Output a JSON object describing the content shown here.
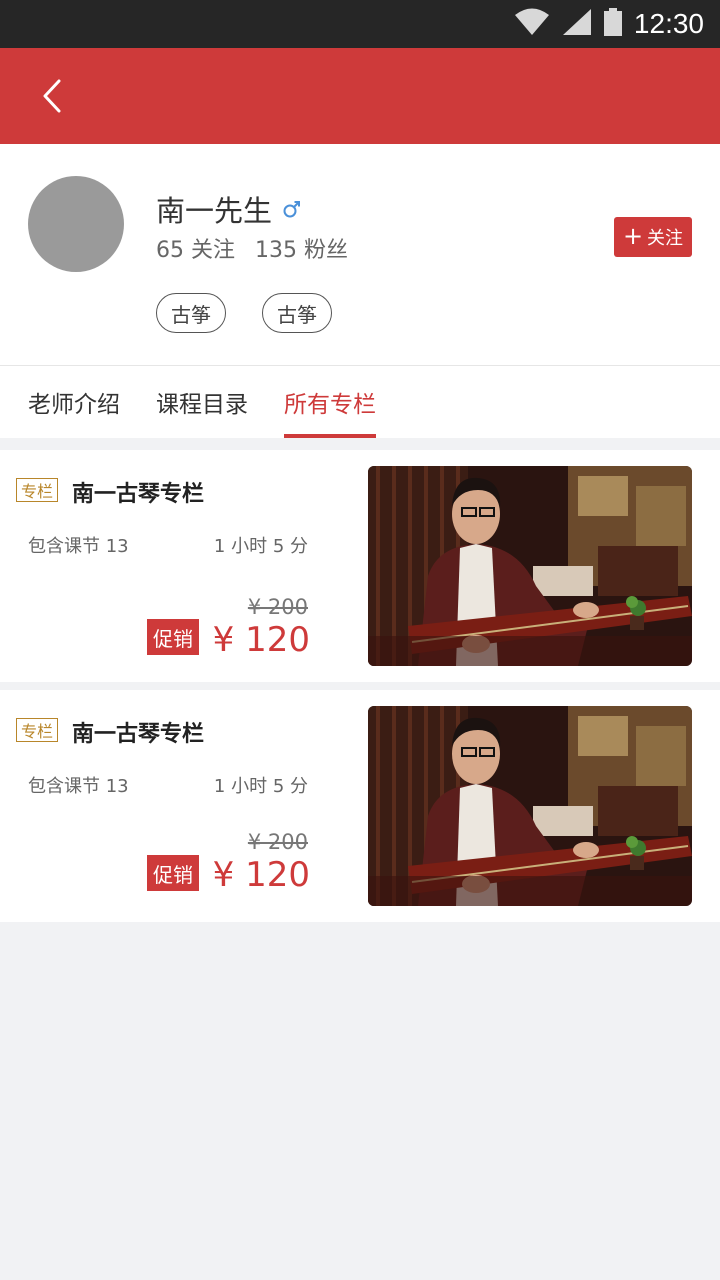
{
  "status_bar": {
    "time": "12:30",
    "icons": [
      "wifi-icon",
      "signal-icon",
      "battery-icon"
    ]
  },
  "profile": {
    "name": "南一先生",
    "gender": "male",
    "following": "65 关注",
    "followers": "135 粉丝",
    "follow_button": "关注",
    "tags": [
      "古筝",
      "古筝"
    ]
  },
  "tabs": [
    {
      "label": "老师介绍",
      "active": false
    },
    {
      "label": "课程目录",
      "active": false
    },
    {
      "label": "所有专栏",
      "active": true
    }
  ],
  "columns": [
    {
      "badge": "专栏",
      "title": "南一古琴专栏",
      "lessons_label": "包含课节",
      "lessons_count": "13",
      "duration": "1 小时 5 分",
      "original_price": "¥ 200",
      "promo_label": "促销",
      "price": "¥ 120"
    },
    {
      "badge": "专栏",
      "title": "南一古琴专栏",
      "lessons_label": "包含课节",
      "lessons_count": "13",
      "duration": "1 小时 5 分",
      "original_price": "¥ 200",
      "promo_label": "促销",
      "price": "¥ 120"
    }
  ],
  "colors": {
    "primary": "#ce3a3a",
    "badge": "#b8862a",
    "status_bar": "#262626",
    "background": "#f1f2f4"
  }
}
